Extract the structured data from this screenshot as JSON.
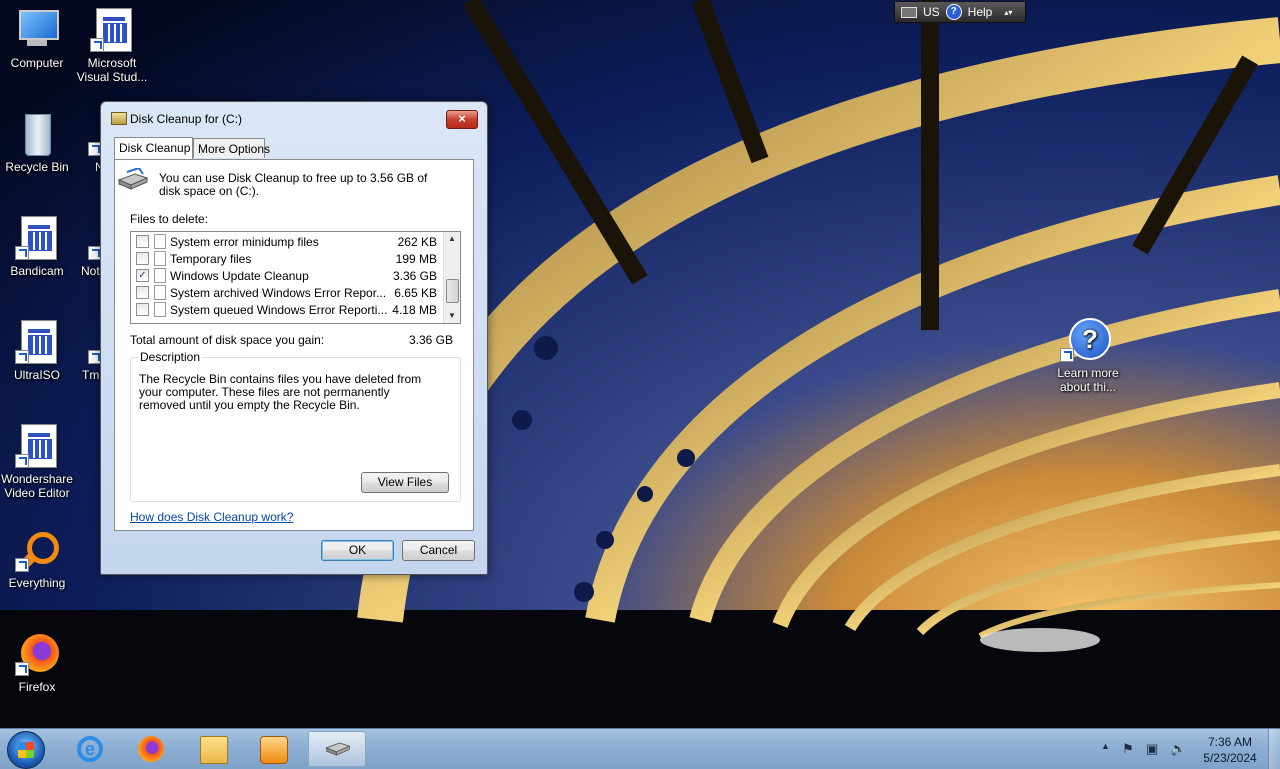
{
  "desktop": {
    "icons": [
      {
        "label": "Computer"
      },
      {
        "label": "Microsoft Visual Stud..."
      },
      {
        "label": "Recycle Bin"
      },
      {
        "label": "N"
      },
      {
        "label": "Bandicam"
      },
      {
        "label": "Not"
      },
      {
        "label": "UltraISO"
      },
      {
        "label": "Tm"
      },
      {
        "label": "Wondershare Video Editor"
      },
      {
        "label": "Everything"
      },
      {
        "label": "Firefox"
      },
      {
        "label": "Learn more about thi..."
      }
    ]
  },
  "langbar": {
    "language": "US",
    "help": "Help"
  },
  "dialog": {
    "title": "Disk Cleanup for  (C:)",
    "close": "×",
    "tabs": [
      {
        "label": "Disk Cleanup",
        "active": true
      },
      {
        "label": "More Options",
        "active": false
      }
    ],
    "intro": "You can use Disk Cleanup to free up to 3.56 GB of disk space on  (C:).",
    "files_label": "Files to delete:",
    "files": [
      {
        "name": "System error minidump files",
        "size": "262 KB",
        "checked": false
      },
      {
        "name": "Temporary files",
        "size": "199 MB",
        "checked": false
      },
      {
        "name": "Windows Update Cleanup",
        "size": "3.36 GB",
        "checked": true
      },
      {
        "name": "System archived Windows Error Repor...",
        "size": "6.65 KB",
        "checked": false
      },
      {
        "name": "System queued Windows Error Reporti...",
        "size": "4.18 MB",
        "checked": false
      }
    ],
    "total_label": "Total amount of disk space you gain:",
    "total_value": "3.36 GB",
    "description_title": "Description",
    "description_text": "The Recycle Bin contains files you have deleted from your computer. These files are not permanently removed until you empty the Recycle Bin.",
    "view_files": "View Files",
    "help_link": "How does Disk Cleanup work?",
    "ok": "OK",
    "cancel": "Cancel"
  },
  "taskbar": {
    "clock_time": "7:36 AM",
    "clock_date": "5/23/2024"
  }
}
